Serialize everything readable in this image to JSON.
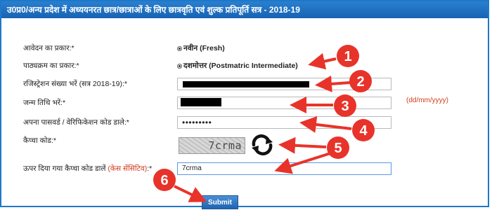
{
  "header": {
    "title": "उ0प्र0/अन्य प्रदेश में अध्ययनरत छात्र/छात्राओं के लिए छात्रवृति एवं शुल्क प्रतिपूर्ति सत्र - 2018-19"
  },
  "form": {
    "application_type": {
      "label": "आवेदन का प्रकार:*",
      "value": "नवीन (Fresh)"
    },
    "course": {
      "label": "पाठ्यक्रम का प्रकार:*",
      "value": "दशमोत्तर (Postmatric Intermediate)"
    },
    "registration": {
      "label": "रजिस्ट्रेशन संख्या भरें (सत्र 2018-19):*"
    },
    "dob": {
      "label": "जन्म तिथि भरें:*",
      "hint": "(dd/mm/yyyy)"
    },
    "password": {
      "label": "अपना पासवर्ड / वेरिफिकेशन कोड डाले:*",
      "value": "•••••••••"
    },
    "captcha": {
      "label": "कैप्चा कोड:*",
      "image_text": "7crma"
    },
    "captcha_input": {
      "label_main": "ऊपर दिया गया कैप्चा कोड डालें",
      "label_note": "(केस सेंसिटिव)",
      "label_suffix": ":*",
      "value": "7crma"
    },
    "submit_label": "Submit"
  },
  "annotations": {
    "color": "#e8332a",
    "numbers": [
      "1",
      "2",
      "3",
      "4",
      "5",
      "6"
    ]
  }
}
